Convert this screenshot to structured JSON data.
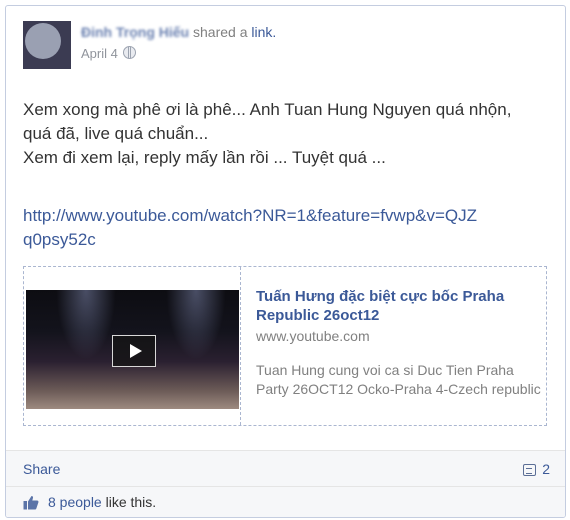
{
  "post": {
    "author_name": "Đinh Trọng Hiếu",
    "shared_text": "shared a",
    "link_word": "link.",
    "date": "April 4",
    "message_lines": [
      "Xem xong mà phê ơi là phê... Anh Tuan Hung Nguyen quá nhộn,",
      "quá đã, live quá chuẩn...",
      "Xem đi xem lại, reply mấy lần rồi ... Tuyệt quá ..."
    ],
    "url": "http://www.youtube.com/watch?NR=1&feature=fvwp&v=QJZq0psy52c"
  },
  "attachment": {
    "title": "Tuấn Hưng đặc biệt cực bốc Praha Republic 26oct12",
    "domain": "www.youtube.com",
    "description": "Tuan Hung cung voi ca si Duc Tien Praha Party 26OCT12 Ocko-Praha 4-Czech republic"
  },
  "actions": {
    "share_label": "Share",
    "comment_count": "2"
  },
  "likes": {
    "people_link": "8 people",
    "suffix": "like this."
  },
  "colors": {
    "link": "#3b5998",
    "footer_bg": "#f6f7f9"
  }
}
